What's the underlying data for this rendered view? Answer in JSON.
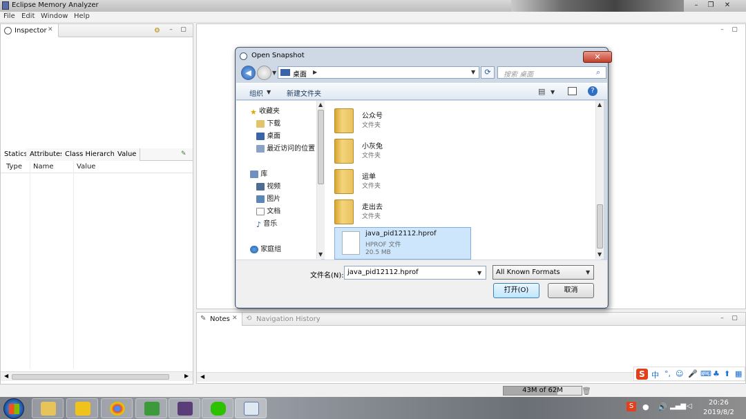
{
  "app": {
    "title": "Eclipse Memory Analyzer"
  },
  "menu": [
    "File",
    "Edit",
    "Window",
    "Help"
  ],
  "inspector": {
    "tab_label": "Inspector",
    "subtabs": [
      "Statics",
      "Attributes",
      "Class Hierarchy",
      "Value"
    ],
    "columns": [
      "Type",
      "Name",
      "Value"
    ]
  },
  "notes": {
    "tab_label": "Notes",
    "nav_history_label": "Navigation History"
  },
  "status": {
    "heap": "43M of 62M"
  },
  "dialog": {
    "title": "Open Snapshot",
    "location": "桌面",
    "search_placeholder": "搜索 桌面",
    "organize_label": "组织",
    "new_folder_label": "新建文件夹",
    "nav": {
      "favorites": "收藏夹",
      "favorites_items": [
        "下载",
        "桌面",
        "最近访问的位置"
      ],
      "libraries": "库",
      "libraries_items": [
        "视频",
        "图片",
        "文档",
        "音乐"
      ],
      "homegroup": "家庭组"
    },
    "files": [
      {
        "name": "公众号",
        "type": "文件夹"
      },
      {
        "name": "小灰兔",
        "type": "文件夹"
      },
      {
        "name": "运单",
        "type": "文件夹"
      },
      {
        "name": "走出去",
        "type": "文件夹"
      },
      {
        "name": "java_pid12112.hprof",
        "type": "HPROF 文件",
        "size": "20.5 MB"
      }
    ],
    "filename_label": "文件名(N):",
    "filename_value": "java_pid12112.hprof",
    "format_value": "All Known Formats",
    "open_label": "打开(O)",
    "cancel_label": "取消"
  },
  "ime": {
    "lang": "中"
  },
  "clock": {
    "time": "20:26",
    "date": "2019/8/2"
  },
  "colors": {
    "selection": "#cde6fb",
    "folder": "#e9c160",
    "dialog_frame": "#cfd9e6"
  }
}
